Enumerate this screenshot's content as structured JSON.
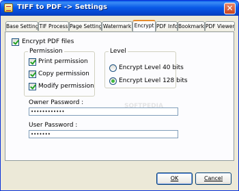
{
  "window": {
    "title": "TIFF to PDF -> Settings",
    "close_glyph": "✕"
  },
  "tabs": [
    {
      "label": "Base Setting"
    },
    {
      "label": "TIF Process"
    },
    {
      "label": "Page Setting"
    },
    {
      "label": "Watermark"
    },
    {
      "label": "Encrypt"
    },
    {
      "label": "PDF Info"
    },
    {
      "label": "Bookmark"
    },
    {
      "label": "PDF Viewer"
    }
  ],
  "active_tab": "Encrypt",
  "encrypt": {
    "enable_label": "Encrypt PDF files",
    "enabled": true,
    "permission": {
      "title": "Permission",
      "items": [
        {
          "label": "Print permission",
          "checked": true
        },
        {
          "label": "Copy permission",
          "checked": true
        },
        {
          "label": "Modify permission",
          "checked": true
        }
      ]
    },
    "level": {
      "title": "Level",
      "options": [
        {
          "label": "Encrypt Level 40 bits",
          "selected": false
        },
        {
          "label": "Encrypt Level 128 bits",
          "selected": true
        }
      ]
    },
    "owner_password": {
      "label": "Owner Password :",
      "value": "••••••••••••"
    },
    "user_password": {
      "label": "User Password :",
      "value": "•••••••"
    }
  },
  "buttons": {
    "ok": "OK",
    "cancel": "Cancel"
  },
  "watermark_text": "SOFTPEDIA"
}
